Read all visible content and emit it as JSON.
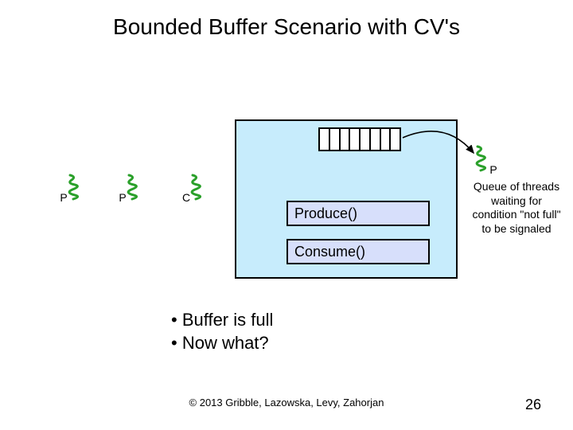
{
  "title": "Bounded Buffer Scenario with CV's",
  "threads": {
    "t1": "P",
    "t2": "P",
    "t3": "C",
    "t4": "P"
  },
  "buffer_cells": 8,
  "methods": {
    "produce": "Produce()",
    "consume": "Consume()"
  },
  "queue_caption": "Queue of threads waiting for condition \"not full\" to be signaled",
  "bullets": {
    "b1": "Buffer is full",
    "b2": "Now what?"
  },
  "copyright": "© 2013 Gribble, Lazowska, Levy, Zahorjan",
  "page_number": "26",
  "colors": {
    "monitor_bg": "#c7ecfc",
    "method_bg": "#d7dffb",
    "squiggle": "#2aa02a"
  }
}
